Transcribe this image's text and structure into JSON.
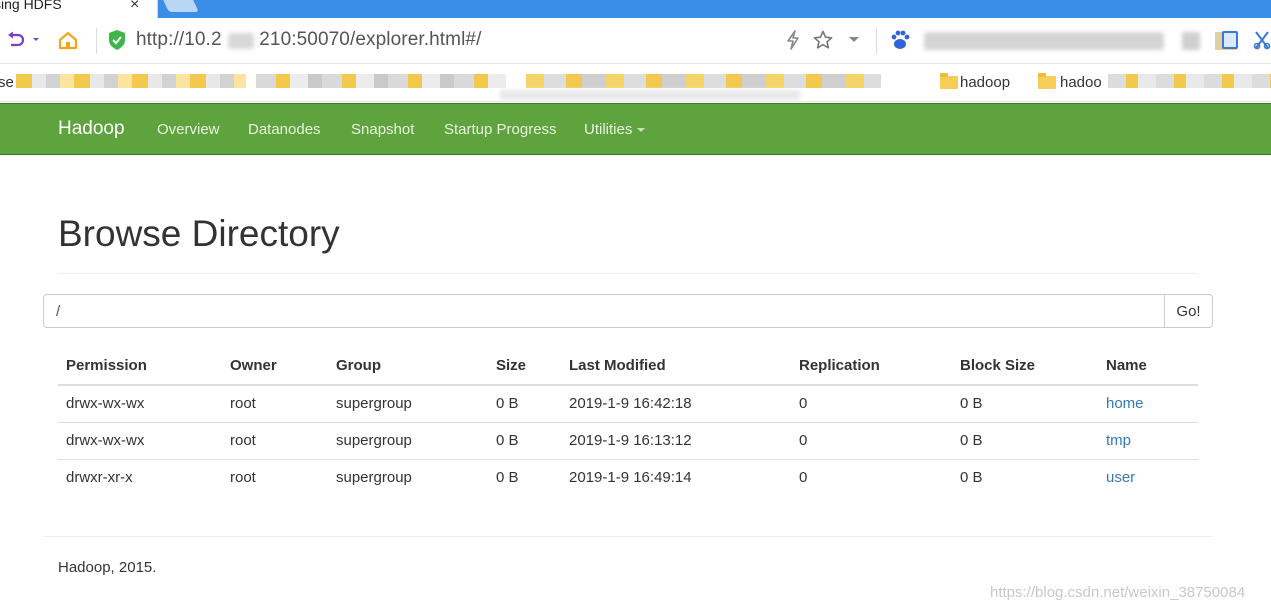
{
  "browser": {
    "tab_title": "sing HDFS",
    "tab_close": "×",
    "url": "http://10.2       210:50070/explorer.html#/",
    "bookmarks": {
      "first_label": "se",
      "hadoop_label_1": "hadoop",
      "hadoop_label_2": "hadoo"
    },
    "icons": [
      "back-icon",
      "home-icon",
      "shield-icon",
      "lightning-icon",
      "star-icon",
      "baidu-icon"
    ]
  },
  "navbar": {
    "brand": "Hadoop",
    "items": [
      {
        "label": "Overview"
      },
      {
        "label": "Datanodes"
      },
      {
        "label": "Snapshot"
      },
      {
        "label": "Startup Progress"
      },
      {
        "label": "Utilities"
      }
    ],
    "color": "#5fa33e"
  },
  "page": {
    "title": "Browse Directory",
    "path_value": "/",
    "go_label": "Go!"
  },
  "table": {
    "headers": [
      "Permission",
      "Owner",
      "Group",
      "Size",
      "Last Modified",
      "Replication",
      "Block Size",
      "Name"
    ],
    "rows": [
      [
        "drwx-wx-wx",
        "root",
        "supergroup",
        "0 B",
        "2019-1-9 16:42:18",
        "0",
        "0 B",
        "home"
      ],
      [
        "drwx-wx-wx",
        "root",
        "supergroup",
        "0 B",
        "2019-1-9 16:13:12",
        "0",
        "0 B",
        "tmp"
      ],
      [
        "drwxr-xr-x",
        "root",
        "supergroup",
        "0 B",
        "2019-1-9 16:49:14",
        "0",
        "0 B",
        "user"
      ]
    ],
    "link_color": "#337ab7"
  },
  "footer": {
    "text": "Hadoop, 2015.",
    "watermark": "https://blog.csdn.net/weixin_38750084"
  }
}
